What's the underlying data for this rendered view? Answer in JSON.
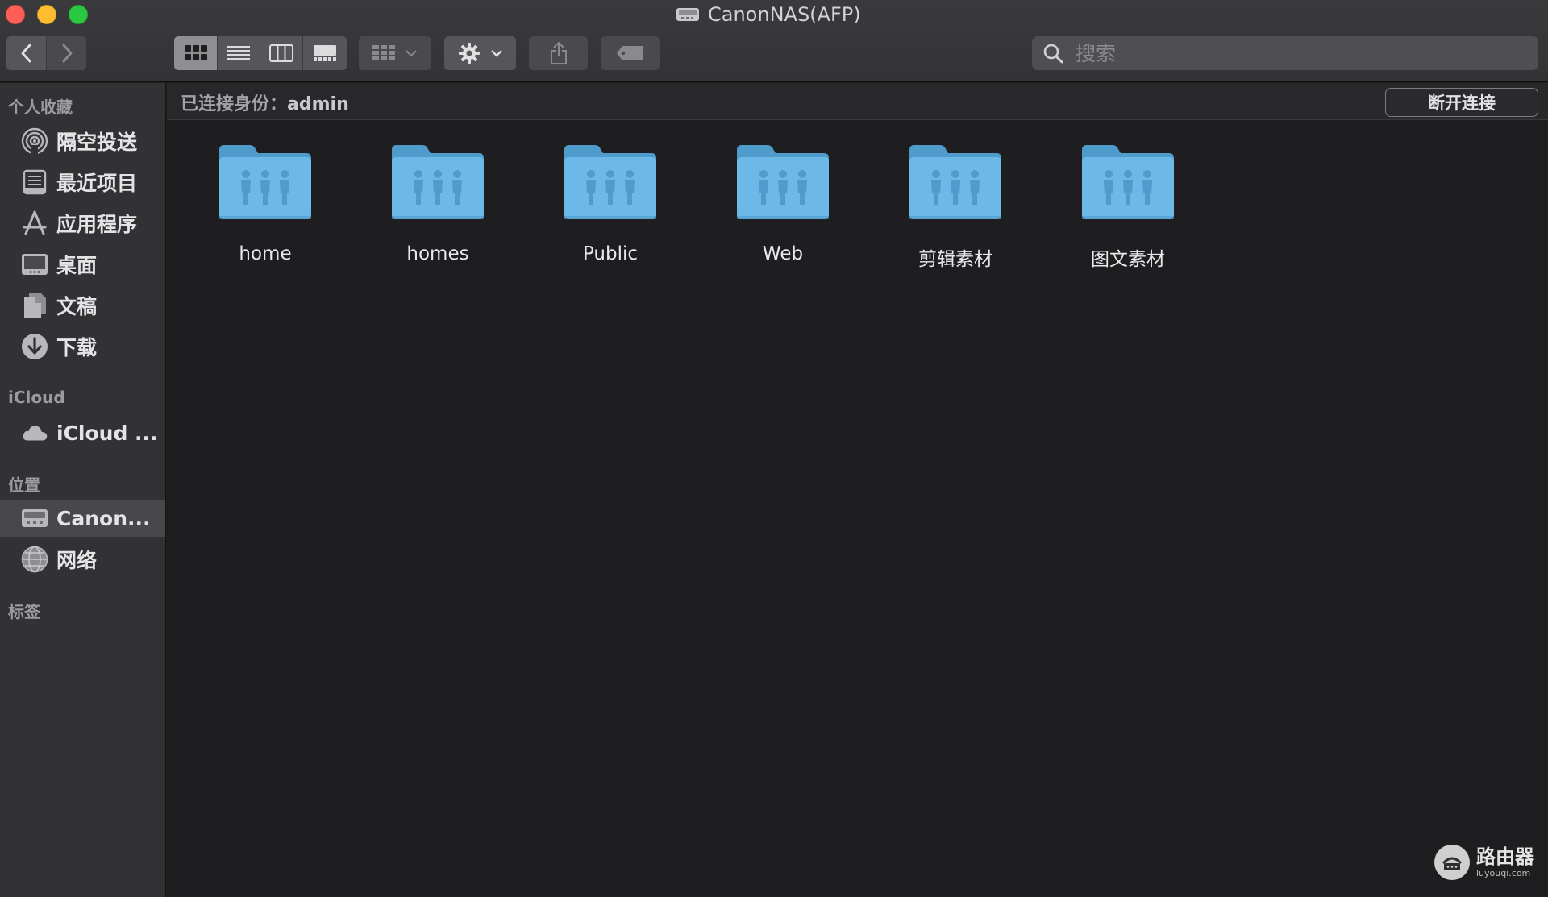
{
  "window": {
    "title": "CanonNAS(AFP)",
    "drive_icon": "network-drive-icon"
  },
  "toolbar": {
    "back_icon": "chevron-left-icon",
    "forward_icon": "chevron-right-icon",
    "view_modes": [
      {
        "name": "icon-view",
        "icon": "grid-icon",
        "active": true
      },
      {
        "name": "list-view",
        "icon": "list-icon",
        "active": false
      },
      {
        "name": "column-view",
        "icon": "columns-icon",
        "active": false
      },
      {
        "name": "gallery-view",
        "icon": "gallery-icon",
        "active": false
      }
    ],
    "group_icon": "group-grid-icon",
    "action_icon": "gear-icon",
    "share_icon": "share-icon",
    "tag_icon": "tag-icon"
  },
  "search": {
    "placeholder": "搜索",
    "value": ""
  },
  "sidebar": {
    "sections": [
      {
        "title": "个人收藏"
      },
      {
        "title": "iCloud"
      },
      {
        "title": "位置"
      },
      {
        "title": "标签"
      }
    ],
    "favorites": [
      {
        "label": "隔空投送",
        "icon": "airdrop-icon"
      },
      {
        "label": "最近项目",
        "icon": "recents-icon"
      },
      {
        "label": "应用程序",
        "icon": "applications-icon"
      },
      {
        "label": "桌面",
        "icon": "desktop-icon"
      },
      {
        "label": "文稿",
        "icon": "documents-icon"
      },
      {
        "label": "下载",
        "icon": "downloads-icon"
      }
    ],
    "icloud": [
      {
        "label": "iCloud ...",
        "icon": "cloud-icon"
      }
    ],
    "locations": [
      {
        "label": "Canon...",
        "icon": "network-drive-icon",
        "selected": true
      },
      {
        "label": "网络",
        "icon": "globe-icon"
      }
    ]
  },
  "pathbar": {
    "connected_label": "已连接身份：",
    "user": "admin",
    "disconnect_label": "断开连接"
  },
  "folders": [
    {
      "name": "home",
      "icon": "shared-folder-icon"
    },
    {
      "name": "homes",
      "icon": "shared-folder-icon"
    },
    {
      "name": "Public",
      "icon": "shared-folder-icon"
    },
    {
      "name": "Web",
      "icon": "shared-folder-icon"
    },
    {
      "name": "剪辑素材",
      "icon": "shared-folder-icon"
    },
    {
      "name": "图文素材",
      "icon": "shared-folder-icon"
    }
  ],
  "watermark": {
    "main": "路由器",
    "sub": "luyouqi.com"
  },
  "colors": {
    "folder_body": "#6cb8e6",
    "folder_tab": "#4f9bcb",
    "close": "#fd5f57",
    "minimize": "#febc2e",
    "maximize": "#2ac840"
  }
}
